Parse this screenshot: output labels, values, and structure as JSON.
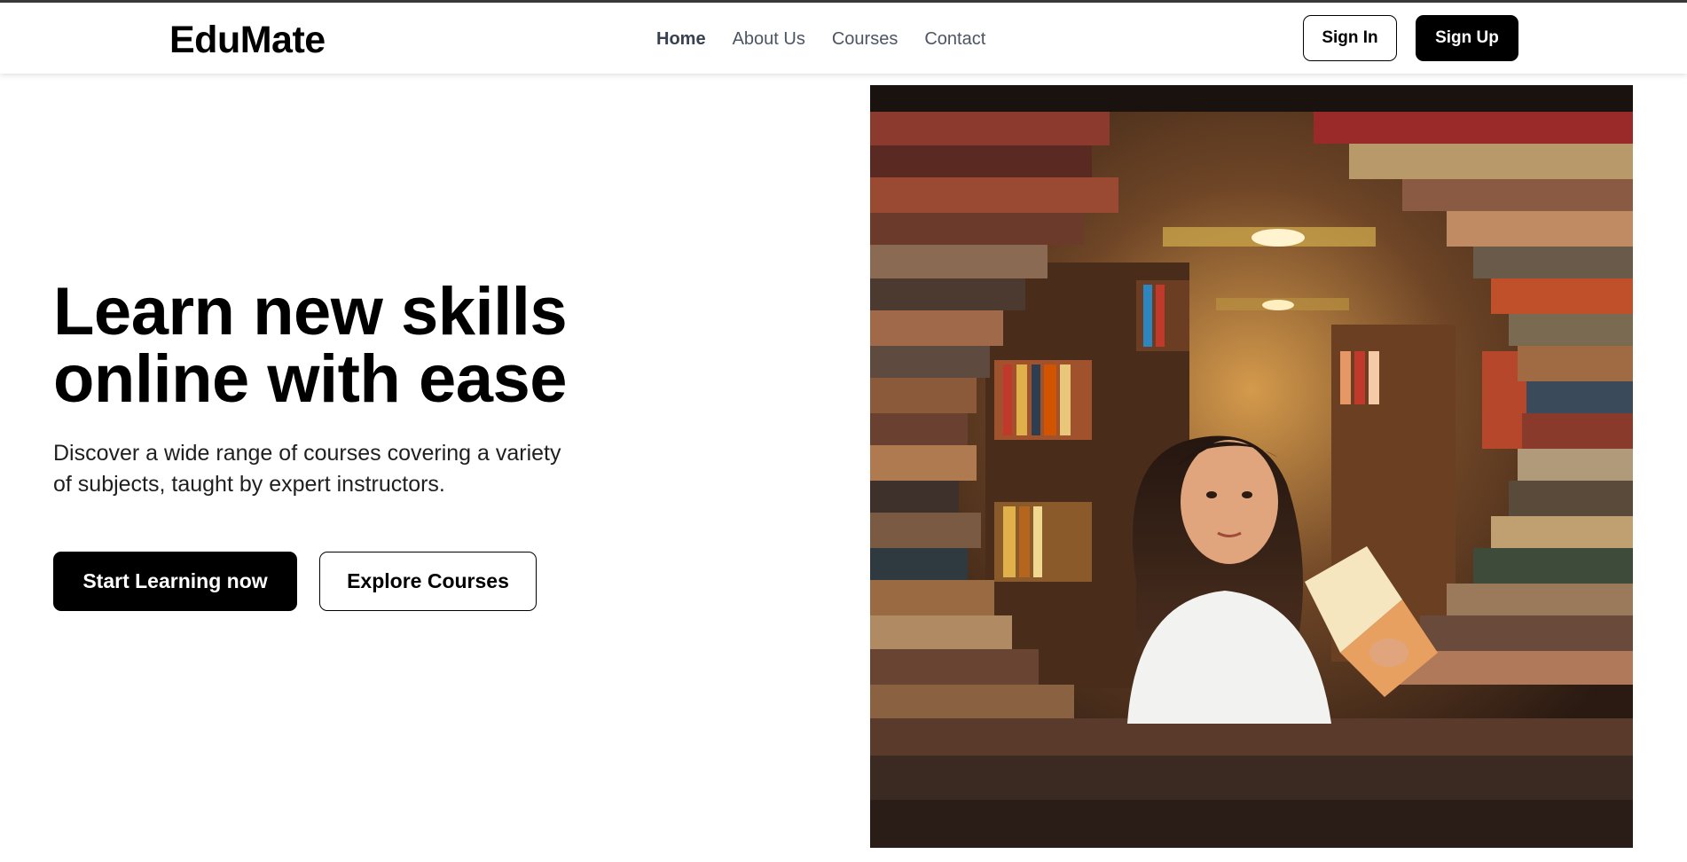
{
  "navbar": {
    "logo": "EduMate",
    "links": [
      {
        "label": "Home",
        "active": true
      },
      {
        "label": "About Us",
        "active": false
      },
      {
        "label": "Courses",
        "active": false
      },
      {
        "label": "Contact",
        "active": false
      }
    ],
    "sign_in_label": "Sign In",
    "sign_up_label": "Sign Up"
  },
  "hero": {
    "title_line1": "Learn new skills",
    "title_line2": "online with ease",
    "subtitle_line1": "Discover a wide range of courses covering a variety",
    "subtitle_line2": "of subjects, taught by expert instructors.",
    "primary_button": "Start Learning now",
    "secondary_button": "Explore Courses"
  },
  "colors": {
    "primary": "#000000",
    "background": "#ffffff",
    "nav_text": "#4b5563"
  }
}
